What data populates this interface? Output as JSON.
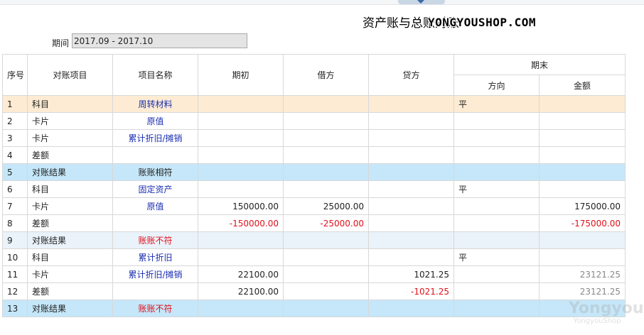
{
  "page": {
    "title": "资产账与总账对账",
    "watermark": "YONGYOUSHOP.COM",
    "corner_watermark": "Yongyou",
    "corner_watermark_sub": "YongyouShop"
  },
  "period": {
    "label": "期间",
    "value": "2017.09 - 2017.10"
  },
  "table": {
    "headers": {
      "index": "序号",
      "item": "对账项目",
      "name": "项目名称",
      "opening": "期初",
      "debit": "借方",
      "credit": "贷方",
      "ending": "期末",
      "direction": "方向",
      "amount": "金额"
    },
    "rows": [
      {
        "idx": "1",
        "item": "科目",
        "name": "周转材料",
        "opening": "",
        "debit": "",
        "credit": "",
        "direction": "平",
        "amount": ""
      },
      {
        "idx": "2",
        "item": "卡片",
        "name": "原值",
        "opening": "",
        "debit": "",
        "credit": "",
        "direction": "",
        "amount": ""
      },
      {
        "idx": "3",
        "item": "卡片",
        "name": "累计折旧/摊销",
        "opening": "",
        "debit": "",
        "credit": "",
        "direction": "",
        "amount": ""
      },
      {
        "idx": "4",
        "item": "差额",
        "name": "",
        "opening": "",
        "debit": "",
        "credit": "",
        "direction": "",
        "amount": ""
      },
      {
        "idx": "5",
        "item": "对账结果",
        "name": "账账相符",
        "opening": "",
        "debit": "",
        "credit": "",
        "direction": "",
        "amount": ""
      },
      {
        "idx": "6",
        "item": "科目",
        "name": "固定资产",
        "opening": "",
        "debit": "",
        "credit": "",
        "direction": "平",
        "amount": ""
      },
      {
        "idx": "7",
        "item": "卡片",
        "name": "原值",
        "opening": "150000.00",
        "debit": "25000.00",
        "credit": "",
        "direction": "",
        "amount": "175000.00"
      },
      {
        "idx": "8",
        "item": "差额",
        "name": "",
        "opening": "-150000.00",
        "debit": "-25000.00",
        "credit": "",
        "direction": "",
        "amount": "-175000.00"
      },
      {
        "idx": "9",
        "item": "对账结果",
        "name": "账账不符",
        "opening": "",
        "debit": "",
        "credit": "",
        "direction": "",
        "amount": ""
      },
      {
        "idx": "10",
        "item": "科目",
        "name": "累计折旧",
        "opening": "",
        "debit": "",
        "credit": "",
        "direction": "平",
        "amount": ""
      },
      {
        "idx": "11",
        "item": "卡片",
        "name": "累计折旧/摊销",
        "opening": "22100.00",
        "debit": "",
        "credit": "1021.25",
        "direction": "",
        "amount": "23121.25"
      },
      {
        "idx": "12",
        "item": "差额",
        "name": "",
        "opening": "22100.00",
        "debit": "",
        "credit": "-1021.25",
        "direction": "",
        "amount": "23121.25"
      },
      {
        "idx": "13",
        "item": "对账结果",
        "name": "账账不符",
        "opening": "",
        "debit": "",
        "credit": "",
        "direction": "",
        "amount": ""
      }
    ]
  }
}
